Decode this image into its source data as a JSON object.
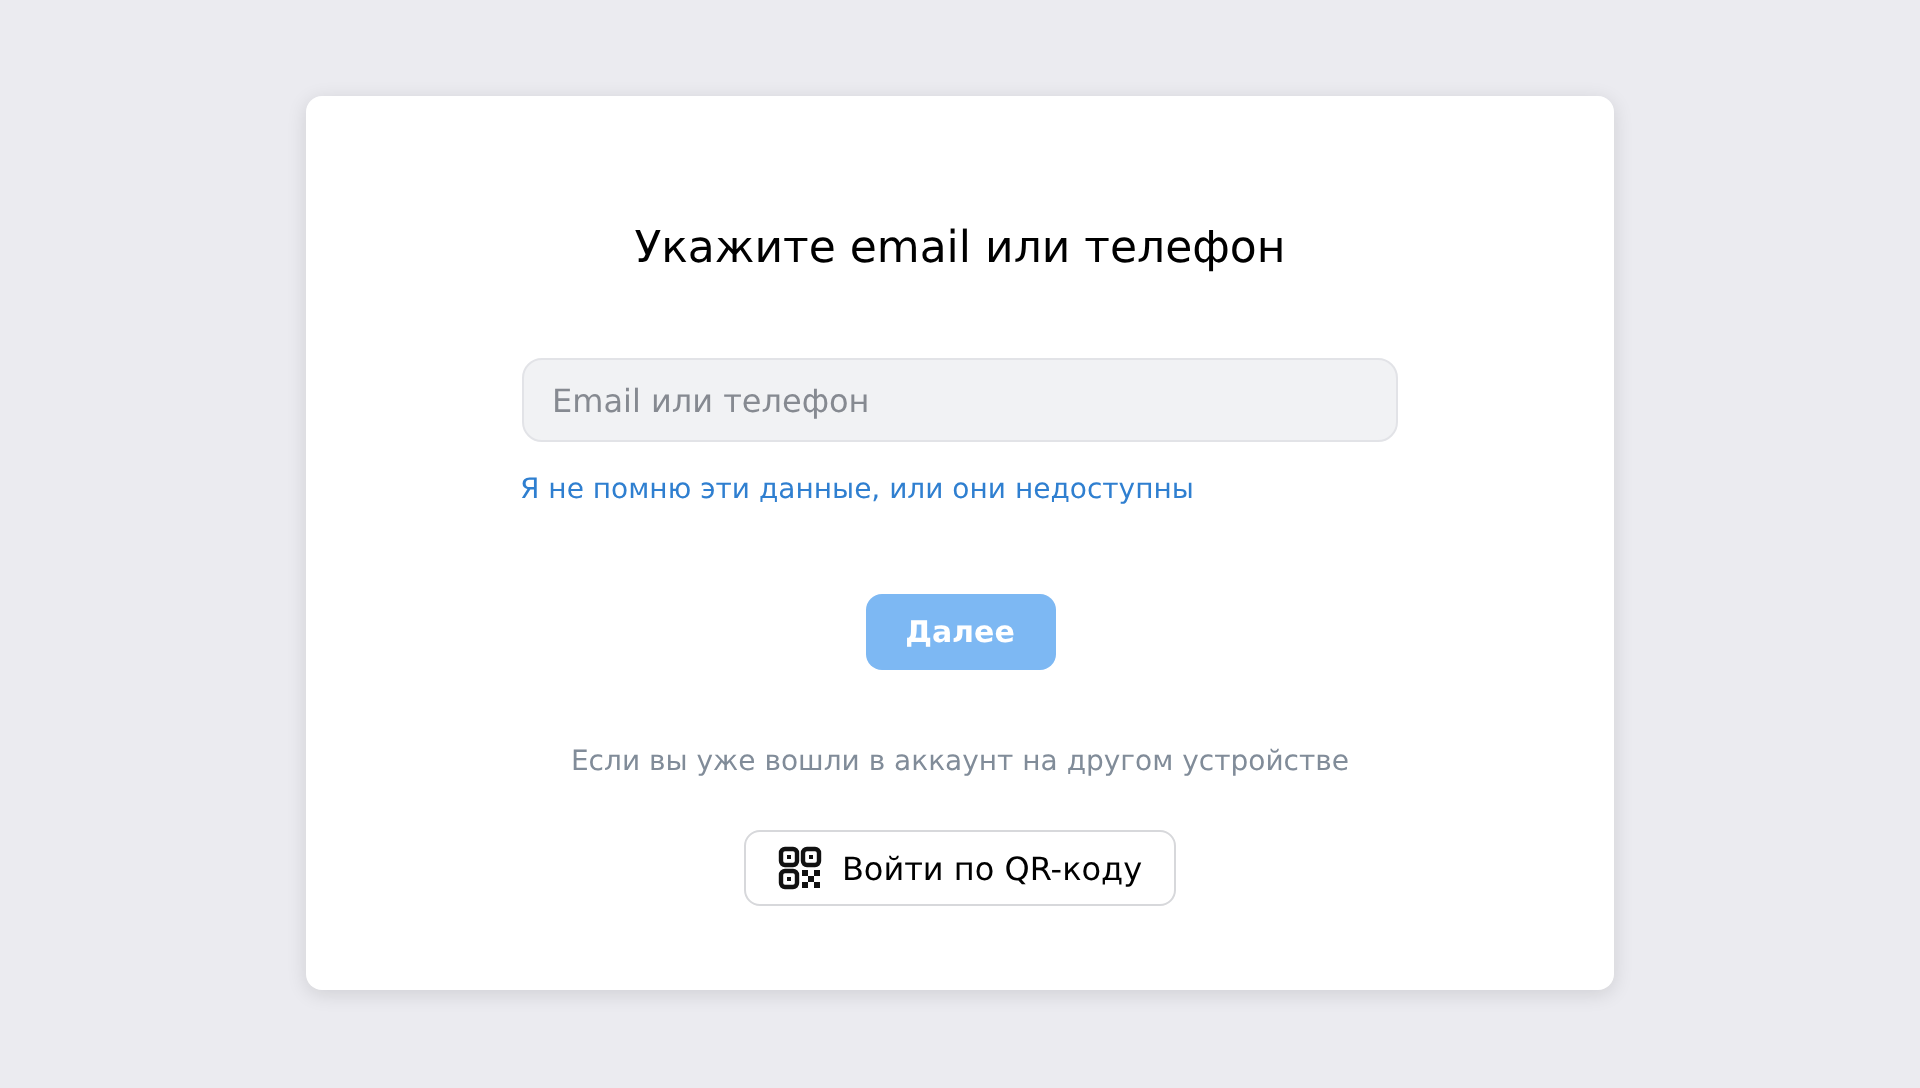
{
  "title": "Укажите email или телефон",
  "login_field": {
    "placeholder": "Email или телефон"
  },
  "forgot_link": "Я не помню эти данные, или они недоступны",
  "next_button": {
    "label": "Далее",
    "disabled": true
  },
  "qr_hint": "Если вы уже вошли в аккаунт на другом устройстве",
  "qr_button": {
    "label": "Войти по QR-коду"
  }
}
